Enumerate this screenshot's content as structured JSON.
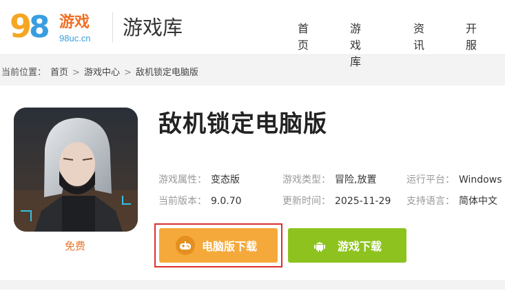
{
  "header": {
    "logo_game_text": "游戏",
    "logo_domain": "98uc.cn",
    "logo_digits": [
      "9",
      "8"
    ],
    "section_title": "游戏库",
    "nav": [
      "首页",
      "游戏库",
      "资讯",
      "开服"
    ]
  },
  "breadcrumb": {
    "prefix": "当前位置：",
    "items": [
      "首页",
      "游戏中心",
      "敌机锁定电脑版"
    ],
    "separator": ">"
  },
  "game": {
    "title": "敌机锁定电脑版",
    "price_label": "免费",
    "attributes": [
      {
        "key": "游戏属性：",
        "value": "变态版"
      },
      {
        "key": "游戏类型：",
        "value": "冒险,放置"
      },
      {
        "key": "运行平台：",
        "value": "Windows"
      },
      {
        "key": "当前版本：",
        "value": "9.0.70"
      },
      {
        "key": "更新时间：",
        "value": "2025-11-29"
      },
      {
        "key": "支持语言：",
        "value": "简体中文"
      }
    ]
  },
  "buttons": {
    "pc_download": "电脑版下载",
    "game_download": "游戏下载"
  },
  "colors": {
    "pc_button": "#f5a93b",
    "game_button": "#8ec31f",
    "highlight_outline": "#d9302c",
    "free_text": "#e8752a",
    "logo_orange": "#f26d21",
    "logo_blue": "#3a9de0"
  }
}
